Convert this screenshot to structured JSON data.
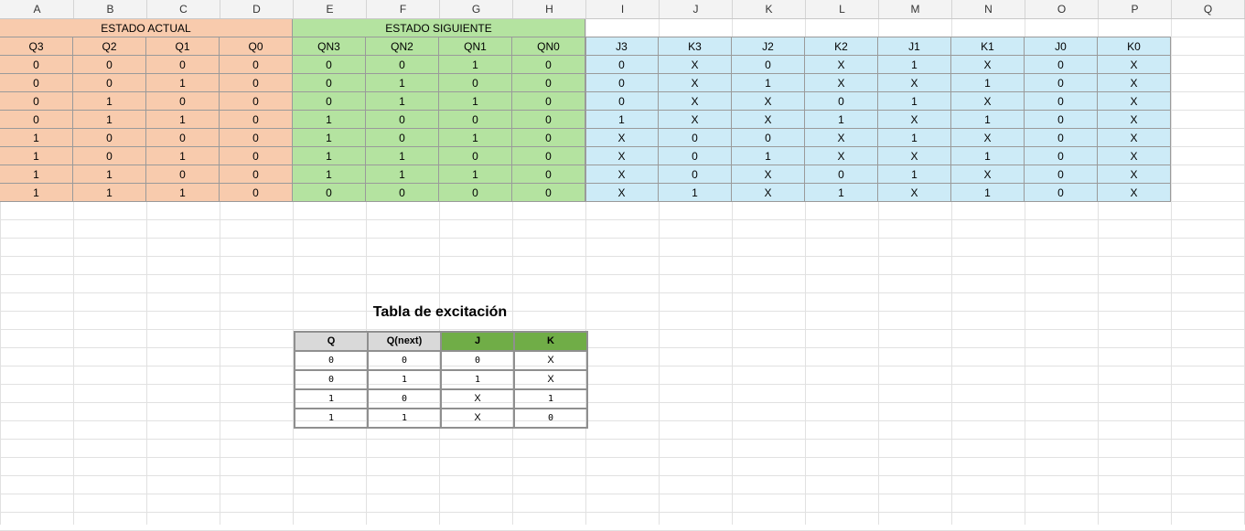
{
  "columns": [
    "A",
    "B",
    "C",
    "D",
    "E",
    "F",
    "G",
    "H",
    "I",
    "J",
    "K",
    "L",
    "M",
    "N",
    "O",
    "P",
    "Q"
  ],
  "groups": {
    "estado_actual": "ESTADO ACTUAL",
    "estado_siguiente": "ESTADO SIGUIENTE"
  },
  "headers": [
    "Q3",
    "Q2",
    "Q1",
    "Q0",
    "QN3",
    "QN2",
    "QN1",
    "QN0",
    "J3",
    "K3",
    "J2",
    "K2",
    "J1",
    "K1",
    "J0",
    "K0"
  ],
  "rows": [
    [
      "0",
      "0",
      "0",
      "0",
      "0",
      "0",
      "1",
      "0",
      "0",
      "X",
      "0",
      "X",
      "1",
      "X",
      "0",
      "X"
    ],
    [
      "0",
      "0",
      "1",
      "0",
      "0",
      "1",
      "0",
      "0",
      "0",
      "X",
      "1",
      "X",
      "X",
      "1",
      "0",
      "X"
    ],
    [
      "0",
      "1",
      "0",
      "0",
      "0",
      "1",
      "1",
      "0",
      "0",
      "X",
      "X",
      "0",
      "1",
      "X",
      "0",
      "X"
    ],
    [
      "0",
      "1",
      "1",
      "0",
      "1",
      "0",
      "0",
      "0",
      "1",
      "X",
      "X",
      "1",
      "X",
      "1",
      "0",
      "X"
    ],
    [
      "1",
      "0",
      "0",
      "0",
      "1",
      "0",
      "1",
      "0",
      "X",
      "0",
      "0",
      "X",
      "1",
      "X",
      "0",
      "X"
    ],
    [
      "1",
      "0",
      "1",
      "0",
      "1",
      "1",
      "0",
      "0",
      "X",
      "0",
      "1",
      "X",
      "X",
      "1",
      "0",
      "X"
    ],
    [
      "1",
      "1",
      "0",
      "0",
      "1",
      "1",
      "1",
      "0",
      "X",
      "0",
      "X",
      "0",
      "1",
      "X",
      "0",
      "X"
    ],
    [
      "1",
      "1",
      "1",
      "0",
      "0",
      "0",
      "0",
      "0",
      "X",
      "1",
      "X",
      "1",
      "X",
      "1",
      "0",
      "X"
    ]
  ],
  "excitacion": {
    "title": "Tabla de excitación",
    "headers": [
      "Q",
      "Q(next)",
      "J",
      "K"
    ],
    "rows": [
      [
        "0",
        "0",
        "0",
        "X"
      ],
      [
        "0",
        "1",
        "1",
        "X"
      ],
      [
        "1",
        "0",
        "X",
        "1"
      ],
      [
        "1",
        "1",
        "X",
        "0"
      ]
    ]
  }
}
